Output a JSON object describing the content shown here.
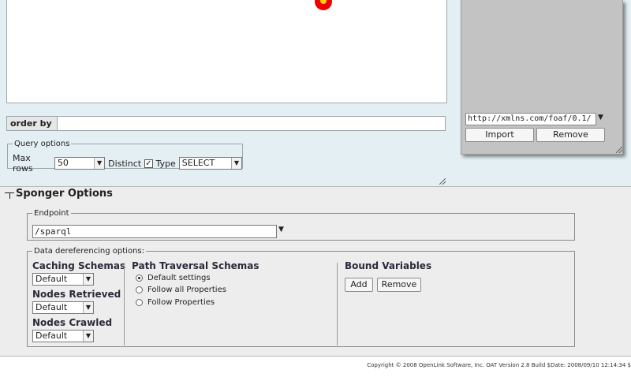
{
  "query": {
    "order_by_label": "order by",
    "options_legend": "Query options",
    "max_rows_label": "Max rows",
    "max_rows_value": "50",
    "distinct_label": "Distinct",
    "distinct_checked": true,
    "type_label": "Type",
    "type_value": "SELECT"
  },
  "namespace_panel": {
    "namespace_value": "http://xmlns.com/foaf/0.1/",
    "import_label": "Import",
    "remove_label": "Remove"
  },
  "sponger": {
    "title": "Sponger Options",
    "endpoint_legend": "Endpoint",
    "endpoint_value": "/sparql",
    "deref_legend": "Data dereferencing options:",
    "caching_schemas_label": "Caching Schemas",
    "caching_schemas_value": "Default",
    "nodes_retrieved_label": "Nodes Retrieved",
    "nodes_retrieved_value": "Default",
    "nodes_crawled_label": "Nodes Crawled",
    "nodes_crawled_value": "Default",
    "path_traversal_label": "Path Traversal Schemas",
    "path_options": [
      "Default settings",
      "Follow all Properties",
      "Follow Properties"
    ],
    "path_selected": "Default settings",
    "bound_variables_label": "Bound Variables",
    "add_label": "Add",
    "remove_label": "Remove"
  },
  "footer": {
    "text": "Copyright © 2008 OpenLink Software, Inc. OAT Version 2.8 Build $Date: 2008/09/10 12:14:34 $"
  },
  "colors": {
    "top_background": "#e4eff4",
    "panel_background": "#c3c3c3",
    "bottom_background": "#ededed",
    "marker_red": "#e00000",
    "marker_yellow": "#ffd200"
  },
  "icons": [
    "dropdown-arrow-icon",
    "checkbox-checked-icon",
    "resize-grip-icon",
    "collapse-toggle-icon",
    "radio-icon"
  ]
}
